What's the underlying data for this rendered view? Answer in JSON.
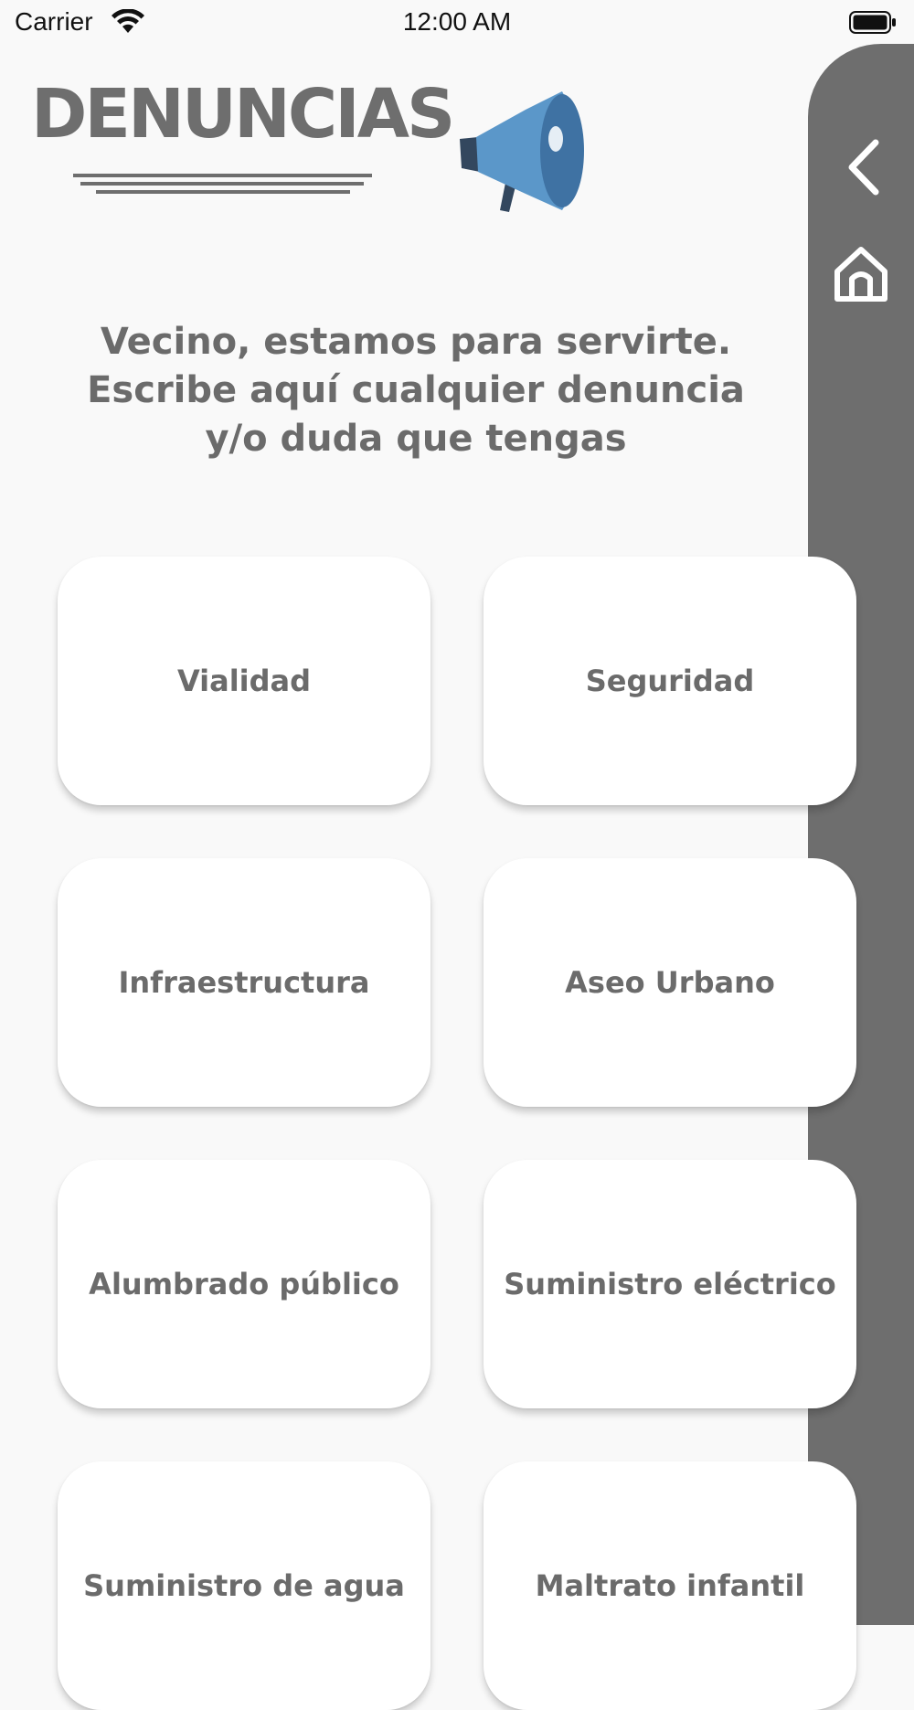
{
  "status_bar": {
    "carrier": "Carrier",
    "time": "12:00 AM"
  },
  "header": {
    "title": "DENUNCIAS",
    "icon": "megaphone-icon"
  },
  "intro_text": "Vecino, estamos para servirte. Escribe aquí cualquier denuncia y/o duda que tengas",
  "side_panel": {
    "back_icon": "chevron-left-icon",
    "home_icon": "home-icon",
    "color": "#6e6e6e"
  },
  "categories": [
    "Vialidad",
    "Seguridad",
    "Infraestructura",
    "Aseo Urbano",
    "Alumbrado público",
    "Suministro eléctrico",
    "Suministro de agua",
    "Maltrato infantil"
  ],
  "colors": {
    "background": "#f9f9f9",
    "text": "#6b6b6b",
    "megaphone": "#5b97c9"
  }
}
